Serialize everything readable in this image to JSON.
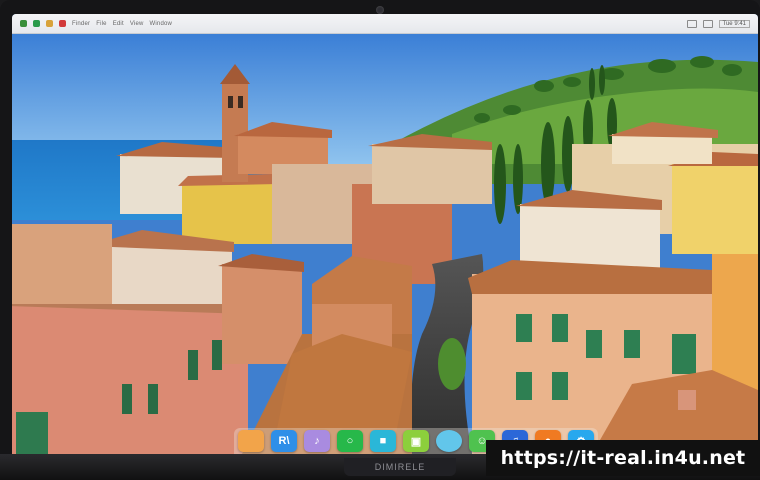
{
  "menubar": {
    "items": [
      "Finder",
      "File",
      "Edit",
      "View",
      "Window"
    ],
    "clock": "Tue 9:41"
  },
  "dock": {
    "apps": [
      {
        "name": "finder-app",
        "glyph": "",
        "color": "#f2a44a"
      },
      {
        "name": "notes-app",
        "glyph": "R\\",
        "color": "#2f8fe8"
      },
      {
        "name": "voice-app",
        "glyph": "♪",
        "color": "#a98be0"
      },
      {
        "name": "messages-app",
        "glyph": "○",
        "color": "#27b84a"
      },
      {
        "name": "files-app",
        "glyph": "■",
        "color": "#2ab7d8"
      },
      {
        "name": "photos-app",
        "glyph": "▣",
        "color": "#8ccf3c"
      },
      {
        "name": "cloud-app",
        "glyph": "",
        "color": "#62c6ea"
      },
      {
        "name": "chat-app",
        "glyph": "☺",
        "color": "#4fc24f"
      },
      {
        "name": "music-app",
        "glyph": "♫",
        "color": "#2b67d8"
      },
      {
        "name": "store-app",
        "glyph": "●",
        "color": "#f07a22"
      },
      {
        "name": "settings-app",
        "glyph": "⚙",
        "color": "#28a8ee"
      }
    ]
  },
  "watermark": {
    "url": "https://it-real.in4u.net"
  },
  "laptop": {
    "brand": "DIMIRELE"
  }
}
